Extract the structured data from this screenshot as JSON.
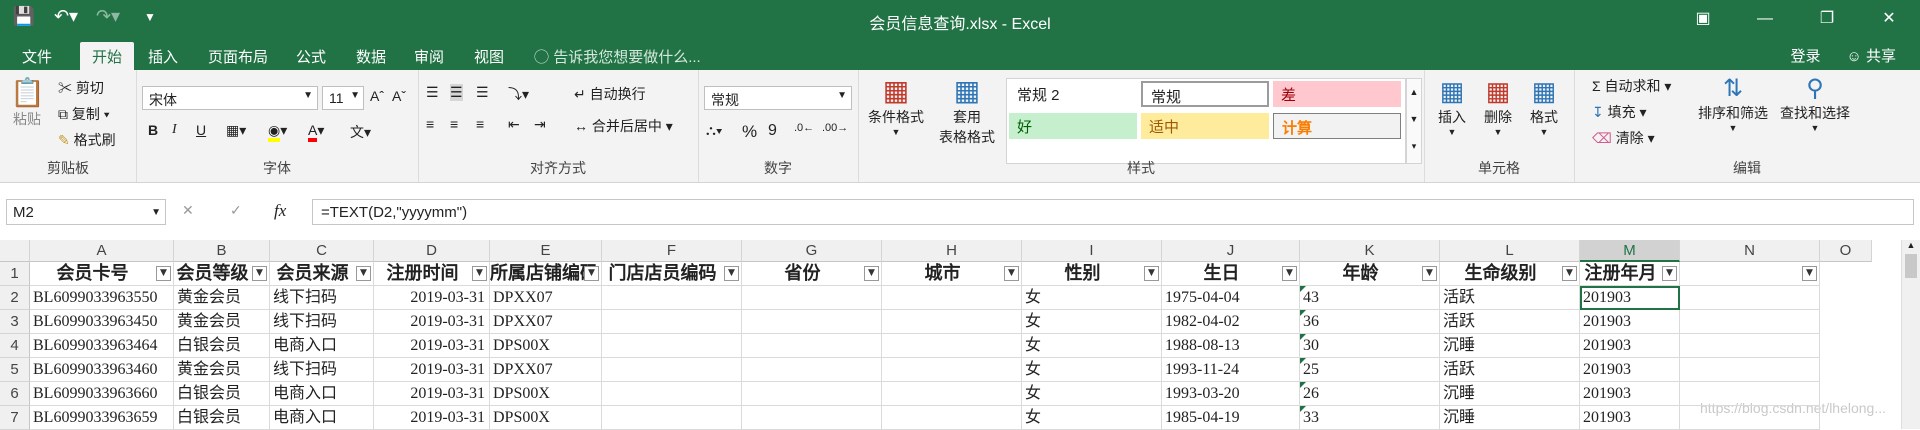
{
  "title_bar": {
    "title": "会员信息查询.xlsx - Excel"
  },
  "tabs": [
    "文件",
    "开始",
    "插入",
    "页面布局",
    "公式",
    "数据",
    "审阅",
    "视图"
  ],
  "tell_me": "告诉我您想要做什么...",
  "account": {
    "login": "登录",
    "share": "共享"
  },
  "clipboard": {
    "paste": "粘贴",
    "cut": "剪切",
    "copy": "复制",
    "format_painter": "格式刷",
    "label": "剪贴板"
  },
  "font": {
    "name": "宋体",
    "size": "11",
    "label": "字体",
    "bold": "B",
    "italic": "I",
    "underline": "U"
  },
  "alignment": {
    "wrap": "自动换行",
    "merge": "合并后居中",
    "label": "对齐方式"
  },
  "number": {
    "format": "常规",
    "percent": "%",
    "comma": "9",
    "label": "数字"
  },
  "styles": {
    "conditional": "条件格式",
    "table": "套用",
    "table2": "表格格式",
    "label": "样式",
    "cells": [
      "常规 2",
      "常规",
      "差",
      "好",
      "适中",
      "计算"
    ]
  },
  "cells_group": {
    "insert": "插入",
    "delete": "删除",
    "format": "格式",
    "label": "单元格"
  },
  "editing": {
    "autosum": "自动求和",
    "fill": "填充",
    "clear": "清除",
    "sort": "排序和筛选",
    "find": "查找和选择",
    "label": "编辑"
  },
  "formula_bar": {
    "name_box": "M2",
    "formula": "=TEXT(D2,\"yyyymm\")",
    "fx": "fx"
  },
  "columns": [
    "A",
    "B",
    "C",
    "D",
    "E",
    "F",
    "G",
    "H",
    "I",
    "J",
    "K",
    "L",
    "M",
    "N",
    "O"
  ],
  "selected_column": "M",
  "header_row": [
    "会员卡号",
    "会员等级",
    "会员来源",
    "注册时间",
    "所属店铺编码",
    "门店店员编码",
    "省份",
    "城市",
    "性别",
    "生日",
    "年龄",
    "生命级别",
    "注册年月",
    ""
  ],
  "rows": [
    {
      "num": "2",
      "A": "BL6099033963550",
      "B": "黄金会员",
      "C": "线下扫码",
      "D": "2019-03-31",
      "E": "DPXX07",
      "I": "女",
      "J": "1975-04-04",
      "K": "43",
      "L": "活跃",
      "M": "201903"
    },
    {
      "num": "3",
      "A": "BL6099033963450",
      "B": "黄金会员",
      "C": "线下扫码",
      "D": "2019-03-31",
      "E": "DPXX07",
      "I": "女",
      "J": "1982-04-02",
      "K": "36",
      "L": "活跃",
      "M": "201903"
    },
    {
      "num": "4",
      "A": "BL6099033963464",
      "B": "白银会员",
      "C": "电商入口",
      "D": "2019-03-31",
      "E": "DPS00X",
      "I": "女",
      "J": "1988-08-13",
      "K": "30",
      "L": "沉睡",
      "M": "201903"
    },
    {
      "num": "5",
      "A": "BL6099033963460",
      "B": "黄金会员",
      "C": "线下扫码",
      "D": "2019-03-31",
      "E": "DPXX07",
      "I": "女",
      "J": "1993-11-24",
      "K": "25",
      "L": "活跃",
      "M": "201903"
    },
    {
      "num": "6",
      "A": "BL6099033963660",
      "B": "白银会员",
      "C": "电商入口",
      "D": "2019-03-31",
      "E": "DPS00X",
      "I": "女",
      "J": "1993-03-20",
      "K": "26",
      "L": "沉睡",
      "M": "201903"
    },
    {
      "num": "7",
      "A": "BL6099033963659",
      "B": "白银会员",
      "C": "电商入口",
      "D": "2019-03-31",
      "E": "DPS00X",
      "I": "女",
      "J": "1985-04-19",
      "K": "33",
      "L": "沉睡",
      "M": "201903"
    }
  ],
  "watermark": "https://blog.csdn.net/lhelong...",
  "colors": {
    "excel_green": "#217346",
    "bad_bg": "#ffc7ce",
    "good_bg": "#c6efce",
    "neutral_bg": "#ffeb9c",
    "calc_text": "#fa7d00"
  }
}
